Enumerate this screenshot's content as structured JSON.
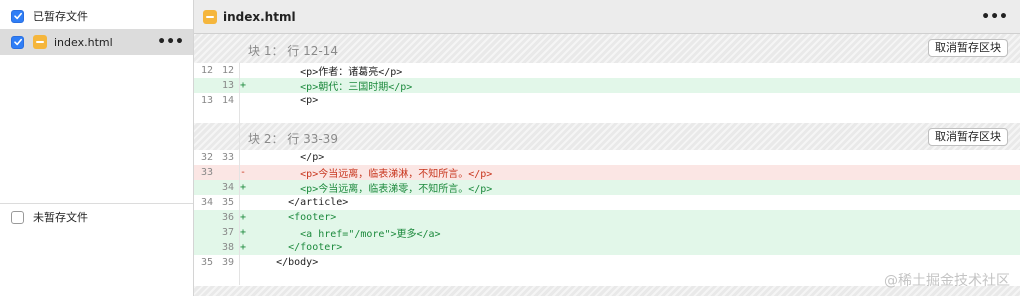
{
  "sidebar": {
    "staged_label": "已暂存文件",
    "staged_files": [
      {
        "name": "index.html",
        "more": "•••"
      }
    ],
    "unstaged_label": "未暂存文件"
  },
  "diff": {
    "file_title": "index.html",
    "menu": "•••",
    "unstage_label": "取消暂存区块",
    "hunks": [
      {
        "title": "块 1： 行 12-14",
        "lines": [
          {
            "type": "ctx",
            "old": "12",
            "new": "12",
            "sign": "",
            "code": "        <p>作者：诸葛亮</p>"
          },
          {
            "type": "add",
            "old": "",
            "new": "13",
            "sign": "+",
            "code": "        <p>朝代：三国时期</p>"
          },
          {
            "type": "ctx",
            "old": "13",
            "new": "14",
            "sign": "",
            "code": "        <p>"
          }
        ]
      },
      {
        "title": "块 2： 行 33-39",
        "lines": [
          {
            "type": "ctx",
            "old": "32",
            "new": "33",
            "sign": "",
            "code": "        </p>"
          },
          {
            "type": "del",
            "old": "33",
            "new": "",
            "sign": "-",
            "code": "        <p>今当远离，临表涕淋，不知所言。</p>"
          },
          {
            "type": "add",
            "old": "",
            "new": "34",
            "sign": "+",
            "code": "        <p>今当远离，临表涕零，不知所言。</p>"
          },
          {
            "type": "ctx",
            "old": "34",
            "new": "35",
            "sign": "",
            "code": "      </article>"
          },
          {
            "type": "add",
            "old": "",
            "new": "36",
            "sign": "+",
            "code": "      <footer>"
          },
          {
            "type": "add",
            "old": "",
            "new": "37",
            "sign": "+",
            "code": "        <a href=\"/more\">更多</a>"
          },
          {
            "type": "add",
            "old": "",
            "new": "38",
            "sign": "+",
            "code": "      </footer>"
          },
          {
            "type": "ctx",
            "old": "35",
            "new": "39",
            "sign": "",
            "code": "    </body>"
          }
        ]
      }
    ]
  },
  "watermark": "@稀土掘金技术社区"
}
